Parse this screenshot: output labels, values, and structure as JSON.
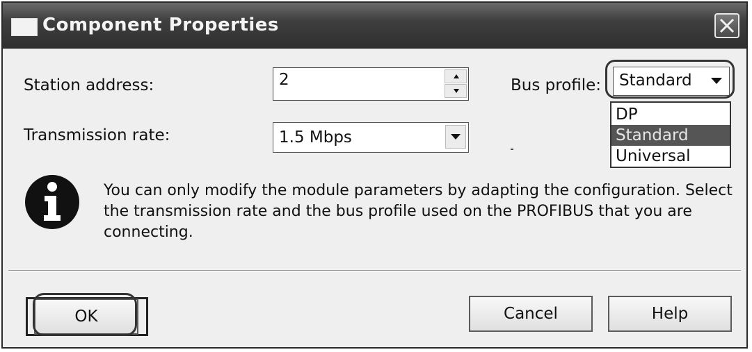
{
  "window": {
    "title": "Component Properties",
    "close_icon": "close-icon"
  },
  "station": {
    "label": "Station address:",
    "value": "2"
  },
  "transmission": {
    "label": "Transmission rate:",
    "value": "1.5 Mbps"
  },
  "bus_profile": {
    "label": "Bus profile:",
    "value": "Standard",
    "options": [
      "DP",
      "Standard",
      "Universal"
    ],
    "selected_index": 1
  },
  "info": {
    "icon": "info-icon",
    "text": "You can only modify the module parameters by adapting the configuration. Select the transmission rate and the bus profile used on the PROFIBUS that you are connecting."
  },
  "buttons": {
    "ok": "OK",
    "cancel": "Cancel",
    "help": "Help"
  }
}
